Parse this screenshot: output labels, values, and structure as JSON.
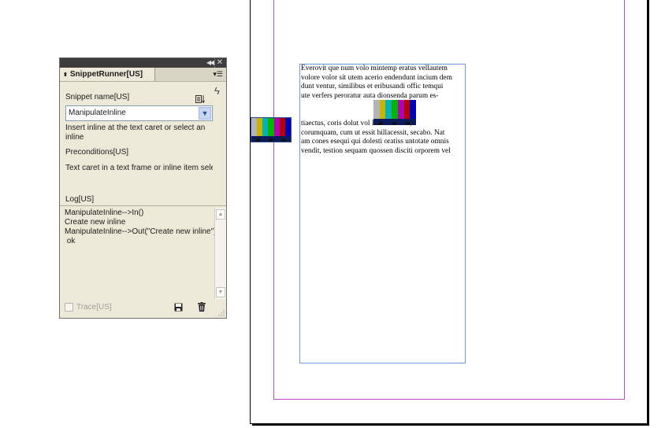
{
  "panel": {
    "tab_title": "SnippetRunner[US]",
    "snippet_name_label": "Snippet name[US]",
    "snippet_selected": "ManipulateInline",
    "description": "Insert inline at the text caret or select an inline",
    "preconditions_label": "Preconditions[US]",
    "preconditions_text": "Text caret in a text frame or inline item selecti",
    "log_label": "Log[US]",
    "log_text": "ManipulateInline-->In()\nCreate new inline\nManipulateInline-->Out(\"Create new inline\")\n ok",
    "trace_label": "Trace[US]",
    "icons": {
      "collapse": "double-chevron-left-icon",
      "close": "close-icon",
      "menu": "panel-menu-icon",
      "sort": "sort-icon",
      "run": "lightning-icon",
      "save": "save-icon",
      "delete": "trash-icon"
    }
  },
  "document": {
    "frame_para_1": [
      "Everovit que num volo mintemp eratus vellautem",
      "volore volor sit utem acerio endendunt incium dem",
      "dunt ventur, similibus et eribusandi offic temqui",
      "ute verfers peroratur auta dionsenda parum es-"
    ],
    "frame_para_2": [
      "tiaectus, coris dolut vol                          labor adi nus,",
      "corumquam, cum ut essit hillacessit, secabo. Nat",
      "am cones esequi qui dolesti oratiss untotate omnis",
      "vendit, testion sequam quossen disciti orporem vel"
    ],
    "colors": {
      "margin_guide": "#c24bc2",
      "frame_border": "#6f9bd8"
    },
    "color_bars": [
      "#b4b4b4",
      "#c8b400",
      "#00b4b4",
      "#00b400",
      "#b400b4",
      "#b40000",
      "#0000b4"
    ]
  }
}
